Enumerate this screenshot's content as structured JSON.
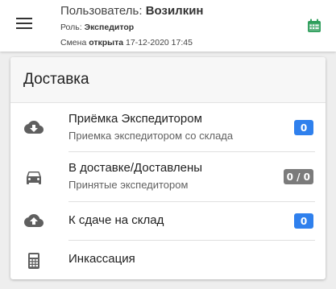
{
  "header": {
    "user_label": "Пользователь:",
    "user_name": "Возилкин",
    "role_label": "Роль:",
    "role_value": "Экспедитор",
    "shift_label": "Смена",
    "shift_status": "открыта",
    "shift_datetime": "17-12-2020 17:45",
    "menu_icon": "hamburger-menu-icon",
    "calendar_icon": "calendar-icon",
    "accent_color": "#2e9e5b"
  },
  "card": {
    "title": "Доставка",
    "items": [
      {
        "title": "Приёмка Экспедитором",
        "subtitle": "Приемка экспедитором со склада",
        "badge": "0",
        "badge_color": "#2f80ed",
        "icon": "cloud-download-icon"
      },
      {
        "title": "В доставке/Доставлены",
        "subtitle": "Принятые экспедитором",
        "badge": "0 / 0",
        "badge_color": "#7b7b7b",
        "icon": "car-icon"
      },
      {
        "title": "К сдаче на склад",
        "subtitle": "",
        "badge": "0",
        "badge_color": "#2f80ed",
        "icon": "cloud-upload-icon"
      },
      {
        "title": "Инкассация",
        "subtitle": "",
        "badge": "",
        "icon": "calculator-icon"
      }
    ]
  }
}
